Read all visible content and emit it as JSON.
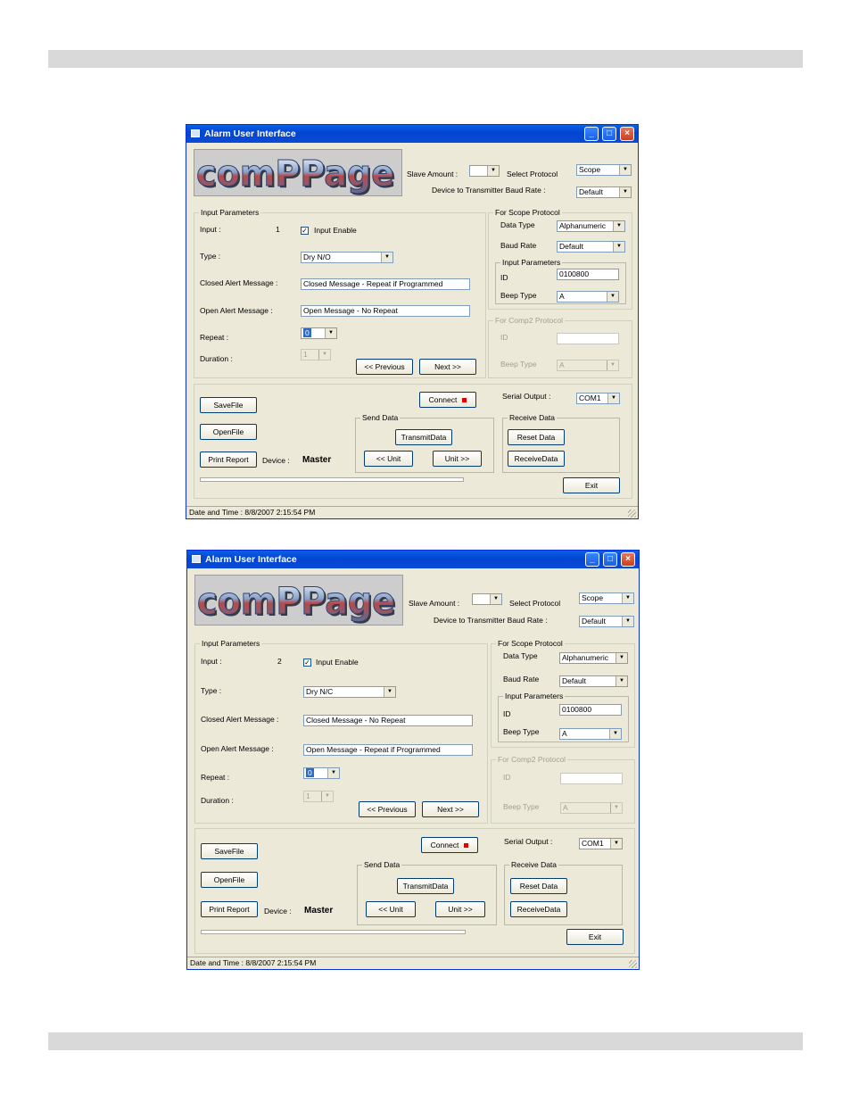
{
  "windows": [
    {
      "title": "Alarm User Interface",
      "logo_text": "comPPage",
      "header": {
        "slave_amount_label": "Slave Amount :",
        "slave_amount_value": "",
        "select_protocol_label": "Select Protocol",
        "protocol_value": "Scope",
        "baud_label": "Device to Transmitter Baud Rate :",
        "baud_value": "Default"
      },
      "input_params": {
        "group_label": "Input Parameters",
        "input_label": "Input :",
        "input_value": "1",
        "enable_label": "Input Enable",
        "enable_checked": true,
        "type_label": "Type :",
        "type_value": "Dry N/O",
        "closed_label": "Closed Alert Message :",
        "closed_value": "Closed Message - Repeat if Programmed",
        "open_label": "Open Alert Message :",
        "open_value": "Open Message - No Repeat",
        "repeat_label": "Repeat :",
        "repeat_value": "0",
        "duration_label": "Duration :",
        "duration_value": "1",
        "previous_label": "<< Previous",
        "next_label": "Next >>"
      },
      "scope": {
        "group_label": "For Scope Protocol",
        "data_type_label": "Data Type",
        "data_type_value": "Alphanumeric",
        "baud_label": "Baud Rate",
        "baud_value": "Default",
        "sub_group_label": "Input Parameters",
        "id_label": "ID",
        "id_value": "0100800",
        "beep_label": "Beep Type",
        "beep_value": "A"
      },
      "comp2": {
        "group_label": "For Comp2 Protocol",
        "id_label": "ID",
        "id_value": "",
        "beep_label": "Beep Type",
        "beep_value": "A"
      },
      "bottom": {
        "savefile": "SaveFile",
        "openfile": "OpenFile",
        "print_report": "Print Report",
        "device_label": "Device :",
        "device_value": "Master",
        "connect": "Connect",
        "serial_label": "Serial Output :",
        "serial_value": "COM1",
        "send_group": "Send Data",
        "transmit": "TransmitData",
        "unit_prev": "<< Unit",
        "unit_next": "Unit >>",
        "receive_group": "Receive Data",
        "reset": "Reset Data",
        "receive": "ReceiveData",
        "exit": "Exit"
      },
      "status": "Date and Time : 8/8/2007 2:15:54 PM"
    },
    {
      "title": "Alarm User Interface",
      "logo_text": "comPPage",
      "header": {
        "slave_amount_label": "Slave Amount :",
        "slave_amount_value": "",
        "select_protocol_label": "Select Protocol",
        "protocol_value": "Scope",
        "baud_label": "Device to Transmitter Baud Rate :",
        "baud_value": "Default"
      },
      "input_params": {
        "group_label": "Input Parameters",
        "input_label": "Input :",
        "input_value": "2",
        "enable_label": "Input Enable",
        "enable_checked": true,
        "type_label": "Type :",
        "type_value": "Dry N/C",
        "closed_label": "Closed Alert Message :",
        "closed_value": "Closed Message - No Repeat",
        "open_label": "Open Alert Message :",
        "open_value": "Open Message - Repeat if Programmed",
        "repeat_label": "Repeat :",
        "repeat_value": "0",
        "duration_label": "Duration :",
        "duration_value": "1",
        "previous_label": "<< Previous",
        "next_label": "Next >>"
      },
      "scope": {
        "group_label": "For Scope Protocol",
        "data_type_label": "Data Type",
        "data_type_value": "Alphanumeric",
        "baud_label": "Baud Rate",
        "baud_value": "Default",
        "sub_group_label": "Input Parameters",
        "id_label": "ID",
        "id_value": "0100800",
        "beep_label": "Beep Type",
        "beep_value": "A"
      },
      "comp2": {
        "group_label": "For Comp2 Protocol",
        "id_label": "ID",
        "id_value": "",
        "beep_label": "Beep Type",
        "beep_value": "A"
      },
      "bottom": {
        "savefile": "SaveFile",
        "openfile": "OpenFile",
        "print_report": "Print Report",
        "device_label": "Device :",
        "device_value": "Master",
        "connect": "Connect",
        "serial_label": "Serial Output :",
        "serial_value": "COM1",
        "send_group": "Send Data",
        "transmit": "TransmitData",
        "unit_prev": "<< Unit",
        "unit_next": "Unit >>",
        "receive_group": "Receive Data",
        "reset": "Reset Data",
        "receive": "ReceiveData",
        "exit": "Exit"
      },
      "status": "Date and Time : 8/8/2007 2:15:54 PM"
    }
  ]
}
